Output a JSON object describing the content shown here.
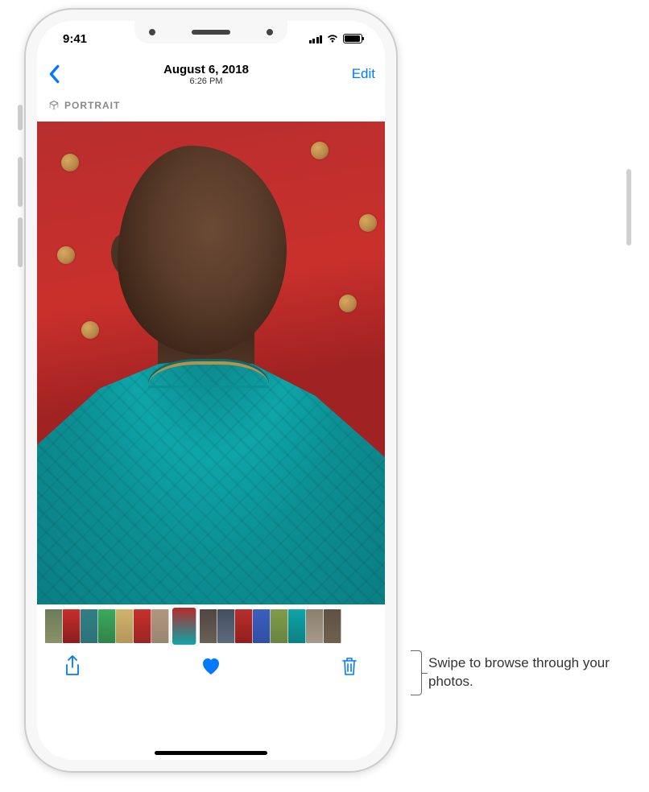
{
  "status": {
    "time": "9:41"
  },
  "nav": {
    "date": "August 6, 2018",
    "time": "6:26 PM",
    "edit": "Edit"
  },
  "badge": {
    "label": "PORTRAIT"
  },
  "colors": {
    "accent": "#007aff"
  },
  "thumbnails": [
    {
      "bg": "linear-gradient(#6b7b5a,#8a9268)"
    },
    {
      "bg": "linear-gradient(#c92e2e,#8a1d1d)"
    },
    {
      "bg": "linear-gradient(#317f84,#2b7378)"
    },
    {
      "bg": "linear-gradient(#3da95e,#2f8449)"
    },
    {
      "bg": "linear-gradient(#d1b36a,#b2975a)"
    },
    {
      "bg": "linear-gradient(#c9302c,#9a2523)"
    },
    {
      "bg": "linear-gradient(#b0977f,#9b8571)"
    },
    {
      "bg": "linear-gradient(#b52a2a,#0ea5a9)",
      "current": true
    },
    {
      "bg": "linear-gradient(#4f4640,#6b6057)"
    },
    {
      "bg": "linear-gradient(#444e5d,#5e6b7d)"
    },
    {
      "bg": "linear-gradient(#b82e2e,#911e1e)"
    },
    {
      "bg": "linear-gradient(#3c5fbd,#2f4fa5)"
    },
    {
      "bg": "linear-gradient(#7e9c4a,#6a843e)"
    },
    {
      "bg": "linear-gradient(#0ea5a9,#0c8084)"
    },
    {
      "bg": "linear-gradient(#8b7f6e,#a69b8a)"
    },
    {
      "bg": "linear-gradient(#5e5144,#70614e)"
    }
  ],
  "callout": {
    "text": "Swipe to browse through your photos."
  }
}
